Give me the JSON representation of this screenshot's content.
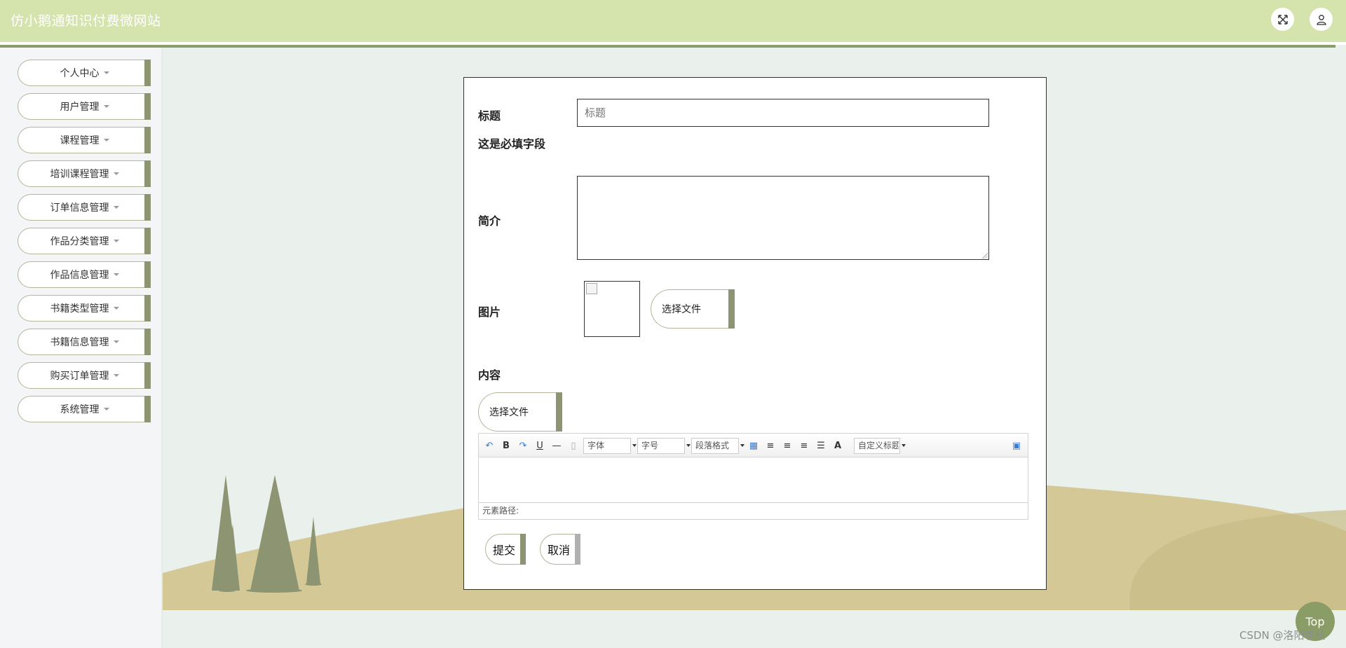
{
  "header": {
    "site_title": "仿小鹅通知识付费微网站",
    "fullscreen_icon": "expand-arrows-icon",
    "user_icon": "user-icon"
  },
  "sidebar": {
    "items": [
      {
        "label": "个人中心"
      },
      {
        "label": "用户管理"
      },
      {
        "label": "课程管理"
      },
      {
        "label": "培训课程管理"
      },
      {
        "label": "订单信息管理"
      },
      {
        "label": "作品分类管理"
      },
      {
        "label": "作品信息管理"
      },
      {
        "label": "书籍类型管理"
      },
      {
        "label": "书籍信息管理"
      },
      {
        "label": "购买订单管理"
      },
      {
        "label": "系统管理"
      }
    ]
  },
  "form": {
    "title_label": "标题",
    "title_placeholder": "标题",
    "required_hint": "这是必填字段",
    "intro_label": "简介",
    "image_label": "图片",
    "image_choose_label": "选择文件",
    "content_label": "内容",
    "content_choose_label": "选择文件",
    "submit_label": "提交",
    "cancel_label": "取消"
  },
  "editor": {
    "font_select": "字体",
    "size_select": "字号",
    "paragraph_select": "段落格式",
    "custom_title_select": "自定义标题",
    "element_path_label": "元素路径:"
  },
  "footer": {
    "top_button": "Top",
    "watermark": "CSDN @洛阳学长"
  },
  "colors": {
    "header_bg": "#d5e3ad",
    "accent": "#8a9d66",
    "button_bar": "#8c9472"
  }
}
